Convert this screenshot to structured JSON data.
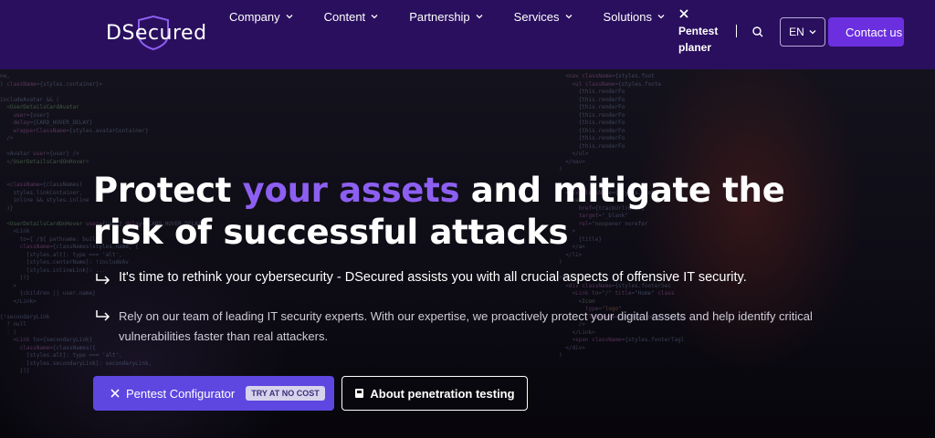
{
  "logo": {
    "text": "DSecured"
  },
  "nav": {
    "items": [
      {
        "label": "Company"
      },
      {
        "label": "Content"
      },
      {
        "label": "Partnership"
      },
      {
        "label": "Services"
      },
      {
        "label": "Solutions"
      }
    ],
    "pentest_planer": "Pentest planer",
    "language": "EN",
    "contact": "Contact us"
  },
  "hero": {
    "headline_pre": "Protect ",
    "headline_accent": "your assets",
    "headline_post": " and mitigate the risk of successful attacks",
    "point1": "It's time to rethink your cybersecurity - DSecured assists you with all crucial aspects of offensive IT security.",
    "point2": "Rely on our team of leading IT security experts. With our expertise, we proactively protect your digital assets and help identify critical vulnerabilities faster than real attackers.",
    "btn_primary": "Pentest Configurator",
    "btn_badge": "TRY AT NO COST",
    "btn_secondary": "About penetration testing"
  },
  "colors": {
    "nav_bg": "#2a0f5e",
    "accent": "#8d5ff1",
    "primary_btn": "#5d47e0",
    "contact_btn": "#6b2fe0"
  }
}
